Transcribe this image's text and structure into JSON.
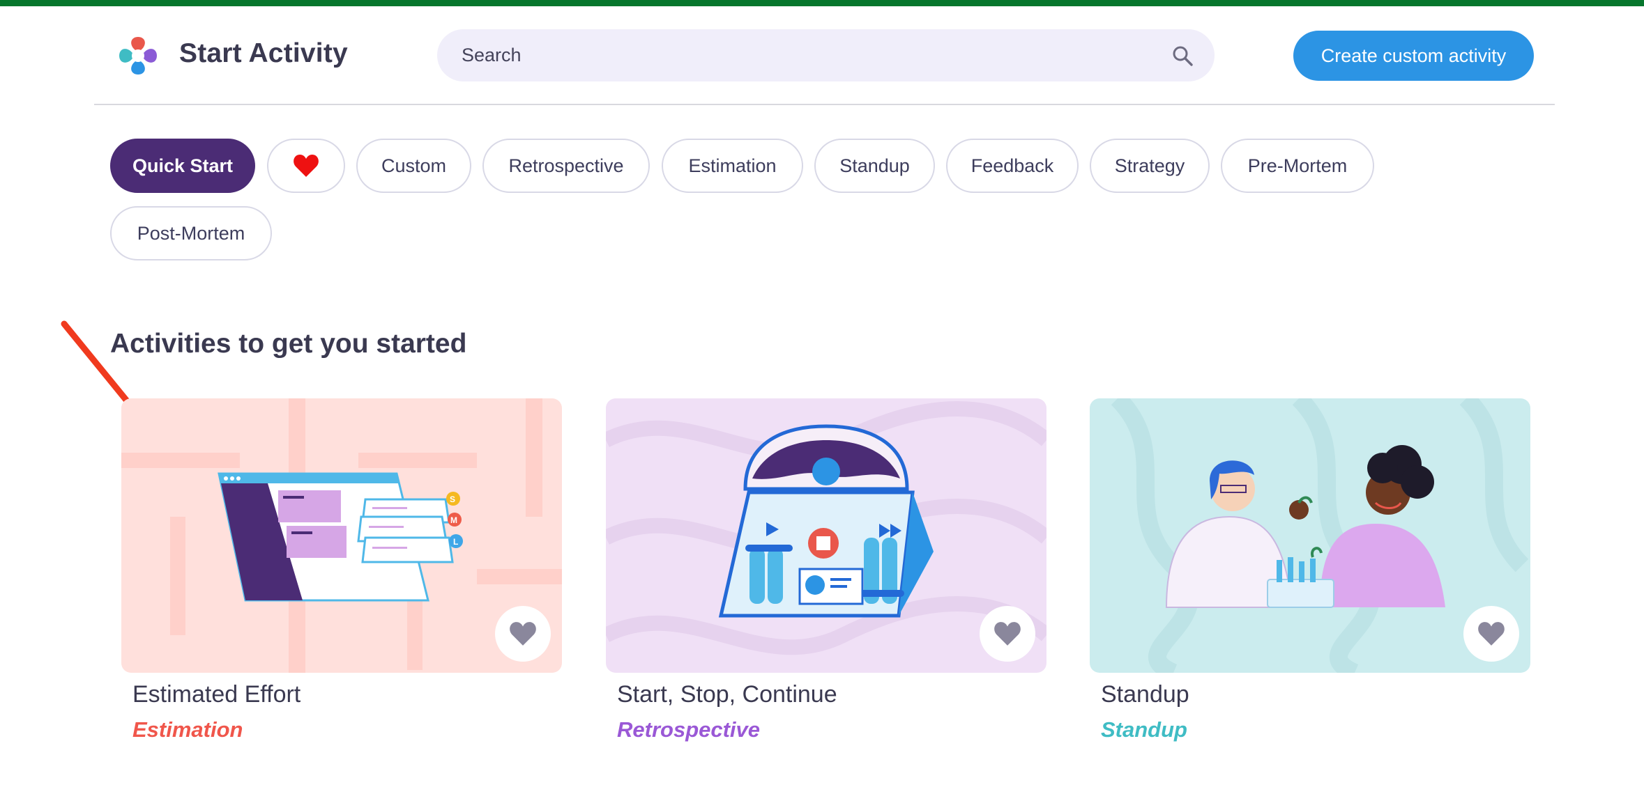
{
  "header": {
    "app_title": "Start Activity",
    "search_placeholder": "Search",
    "search_icon": "search-icon",
    "create_button_label": "Create custom activity"
  },
  "filters": [
    {
      "label": "Quick Start",
      "active": true
    },
    {
      "label": "",
      "icon": "heart-icon"
    },
    {
      "label": "Custom"
    },
    {
      "label": "Retrospective"
    },
    {
      "label": "Estimation"
    },
    {
      "label": "Standup"
    },
    {
      "label": "Feedback"
    },
    {
      "label": "Strategy"
    },
    {
      "label": "Pre-Mortem"
    },
    {
      "label": "Post-Mortem"
    }
  ],
  "section": {
    "title": "Activities to get you started"
  },
  "cards": [
    {
      "title": "Estimated Effort",
      "category": "Estimation",
      "category_color": "#f0564b",
      "bg_color": "#ffe0dc",
      "fav_icon": "heart-icon"
    },
    {
      "title": "Start, Stop, Continue",
      "category": "Retrospective",
      "category_color": "#9a58d6",
      "bg_color": "#f0e0f6",
      "fav_icon": "heart-icon"
    },
    {
      "title": "Standup",
      "category": "Standup",
      "category_color": "#3fbcc4",
      "bg_color": "#cbecee",
      "fav_icon": "heart-icon"
    }
  ],
  "colors": {
    "top_bar": "#07762d",
    "accent_blue": "#2c94e4",
    "active_chip": "#4b2c75",
    "annotation_arrow": "#f03a1e"
  }
}
